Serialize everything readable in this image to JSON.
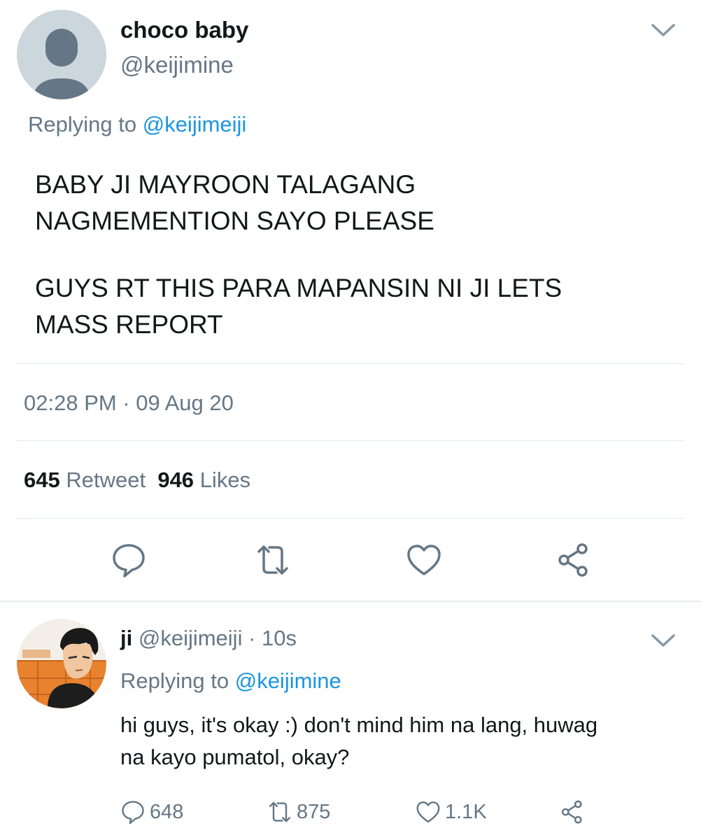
{
  "main_tweet": {
    "display_name": "choco baby",
    "handle": "@keijimine",
    "replying_prefix": "Replying to",
    "replying_to": "@keijimeiji",
    "paragraph1": "BABY JI MAYROON TALAGANG\nNAGMEMENTION SAYO PLEASE",
    "paragraph2": "GUYS RT THIS PARA MAPANSIN NI JI LETS\nMASS REPORT",
    "timestamp": "02:28 PM · 09 Aug 20",
    "retweet_count": "645",
    "retweet_label": "Retweet",
    "like_count": "946",
    "like_label": "Likes",
    "icons": [
      "reply-icon",
      "retweet-icon",
      "like-icon",
      "share-icon"
    ]
  },
  "reply_tweet": {
    "display_name": "ji",
    "handle_time": "@keijimeiji · 10s",
    "replying_prefix": "Replying to",
    "replying_to": "@keijimine",
    "text": "hi guys, it's okay :) don't mind him na lang, huwag\nna kayo pumatol, okay?",
    "reply_count": "648",
    "retweet_count": "875",
    "like_count": "1.1K",
    "icons": [
      "reply-icon",
      "retweet-icon",
      "like-icon",
      "share-icon"
    ]
  },
  "colors": {
    "link": "#1b95e0",
    "muted": "#657786",
    "divider": "#e1e8ed",
    "icon": "#657786"
  }
}
